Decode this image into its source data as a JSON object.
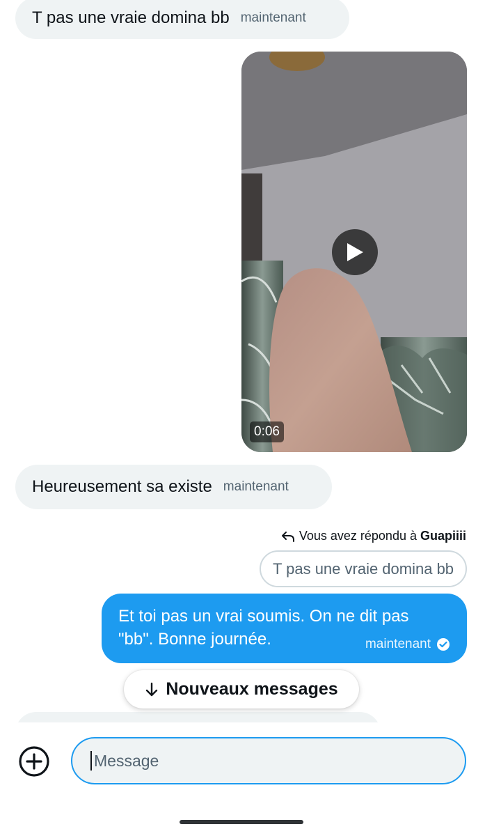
{
  "messages": [
    {
      "text": "T pas une vraie domina bb",
      "time": "maintenant"
    },
    {
      "text": "Heureusement sa existe",
      "time": "maintenant"
    },
    {
      "text": "Et toi pas un vrai soumis. On ne dit pas \"bb\". Bonne journée.",
      "time": "maintenant"
    }
  ],
  "video": {
    "duration": "0:06"
  },
  "reply": {
    "prefix": "Vous avez répondu à ",
    "user": "Guapiiii",
    "quoted_text": "T pas une vraie domina bb"
  },
  "new_messages_label": "Nouveaux messages",
  "composer": {
    "placeholder": "Message"
  },
  "colors": {
    "accent": "#1d9bf0",
    "bubble_in": "#eff3f4",
    "text_secondary": "#536471"
  },
  "icons": [
    "play-icon",
    "reply-arrow-icon",
    "check-circle-icon",
    "arrow-down-icon",
    "add-circle-icon"
  ]
}
